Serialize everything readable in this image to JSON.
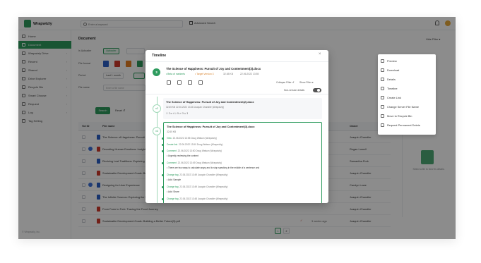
{
  "app": {
    "logo_text": "Wrapwizly"
  },
  "topbar": {
    "search_placeholder": "Enter a keyword",
    "advanced_search": "Advanced Search"
  },
  "sidebar": {
    "items": [
      {
        "label": "Home",
        "chevron": ""
      },
      {
        "label": "Document",
        "chevron": ""
      },
      {
        "label": "Wrapwizly Drive",
        "chevron": "›"
      },
      {
        "label": "Recent",
        "chevron": "›"
      },
      {
        "label": "Shared",
        "chevron": "›"
      },
      {
        "label": "Drive Explorer",
        "chevron": "›"
      },
      {
        "label": "Recycle Bin",
        "chevron": "›"
      },
      {
        "label": "Smart Choose",
        "chevron": "›"
      },
      {
        "label": "Request",
        "chevron": "›"
      },
      {
        "label": "Log",
        "chevron": "›"
      },
      {
        "label": "Tag Setting",
        "chevron": ""
      }
    ],
    "footer": "© Wrapwizly, Inc."
  },
  "main": {
    "title": "Document",
    "hide_filter": "Hide Filter",
    "filters": {
      "is_uploader_label": "Is Uploader",
      "uploader_opt": "Uploader",
      "file_format_label": "File format",
      "period_label": "Period",
      "period_opt": "Last 1 month",
      "file_name_label": "File name",
      "file_name_placeholder": "Enter a file name",
      "search_btn": "Search",
      "reset_btn": "Reset"
    },
    "table": {
      "headers": {
        "id": "Vol ID",
        "file_name": "File name",
        "owner": "Owner"
      },
      "rows": [
        {
          "name": "The Science of Happiness: Pursuit of Joy and Contentment(3).docx",
          "date": "",
          "owner": "Joaquin Chandler"
        },
        {
          "name": "Decoding Human Emotions: Insights into the Mind",
          "date": "",
          "owner": "Regan Lowell"
        },
        {
          "name": "Reviving Lost Traditions: Exploring Cultural Heritage",
          "date": "",
          "owner": "Samantha Pork"
        },
        {
          "name": "Sustainable Development Goals: Building a Better Future",
          "date": "",
          "owner": "Joaquin Chandler"
        },
        {
          "name": "Designing for User Experience",
          "date": "",
          "owner": "Carolyn Lowe"
        },
        {
          "name": "The Infinite Cosmos: Exploring the Universe",
          "date": "",
          "owner": "Joaquin Chandler"
        },
        {
          "name": "From Farm to Fork: Tracing the Food Journey",
          "date": "",
          "owner": "Joaquin Chandler"
        },
        {
          "name": "Sustainable Development Goals: Building a Better Future(3).pdf",
          "date": "3 weeks ago",
          "owner": "Joaquin Chandler"
        }
      ]
    },
    "pager": {
      "current": "1",
      "next": "2"
    },
    "details_hint": "Select a file to view its details."
  },
  "context_menu": {
    "items": [
      "Preview",
      "Download",
      "Details",
      "Timeline",
      "Create Link",
      "Change Server File Name",
      "Move to Recycle Bin",
      "Request Permanent Delete"
    ]
  },
  "timeline": {
    "title": "Timeline",
    "step": "3",
    "doc_name": "The Science of Happiness: Pursuit of Joy and Contentment(3).docx",
    "meta_uploader": "• Beta of markerts",
    "meta_target": "• Target Version 3",
    "meta_size": "32.65 KB",
    "meta_date": "22.06.2022 13:55",
    "collapse_filter": "Collapse Filter",
    "show_filter": "Show Filter",
    "non_version_label": "Non-version details",
    "cards": [
      {
        "badge": "v2",
        "title": "The Science of Happiness: Pursuit of Joy and Contentment(2).docx",
        "meta": "32.65 KB    22.06.2022 13:48    Joaquin Chandler (Wrapwizly)",
        "stats": "☐ 2    ✉ 4    ⇩ 5    ☍ 3    ♙ 3"
      },
      {
        "badge": "v3",
        "title": "The Science of Happiness: Pursuit of Joy and Contentment(3).docx",
        "meta": "32.65 KB",
        "events": [
          {
            "type": "View",
            "meta": "22.06.2022 13:55   Doug Watson (Wrapwizly)",
            "note": ""
          },
          {
            "type": "Create link",
            "meta": "22.06.2022 13:50   Doug Watson (Wrapwizly)",
            "note": ""
          },
          {
            "type": "Comment",
            "meta": "22.06.2022 13:50   Doug Watson (Wrapwizly)",
            "note": "• Urgently reviewing the content"
          },
          {
            "type": "Comment",
            "meta": "22.06.2022 13:49   Doug Watson (Wrapwizly)",
            "note": "• There are two ways to calculate angry and to stop speaking in the middle of a sentence and"
          },
          {
            "type": "Change tag",
            "meta": "22.06.2022 13:49   Joaquin Chandler (Wrapwizly)",
            "note": "• Add: Sample"
          },
          {
            "type": "Change tag",
            "meta": "22.06.2022 13:49   Joaquin Chandler (Wrapwizly)",
            "note": "• Add: Share"
          },
          {
            "type": "Change tag",
            "meta": "22.06.2022 13:48   Joaquin Chandler (Wrapwizly)",
            "note": ""
          }
        ]
      }
    ]
  },
  "colors": {
    "accent": "#2e9b5e",
    "overlay": "rgba(0,0,0,0.45)"
  }
}
